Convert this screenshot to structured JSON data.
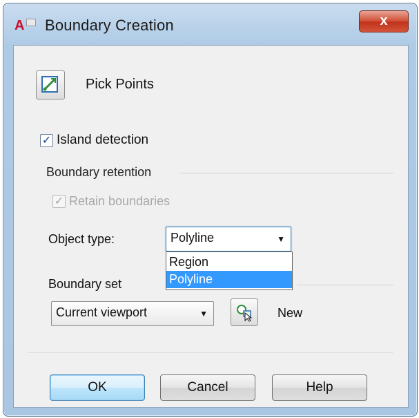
{
  "window": {
    "title": "Boundary Creation",
    "app_icon_letters": "A",
    "close_label": "x"
  },
  "pick_points": {
    "label": "Pick Points"
  },
  "island_detection": {
    "label": "Island detection",
    "checked": true,
    "check_mark": "✓"
  },
  "boundary_retention": {
    "heading": "Boundary retention",
    "retain": {
      "label": "Retain boundaries",
      "checked": true,
      "enabled": false,
      "check_mark": "✓"
    },
    "object_type": {
      "label": "Object type:",
      "selected": "Polyline",
      "options": [
        "Region",
        "Polyline"
      ],
      "highlighted": "Polyline"
    }
  },
  "boundary_set": {
    "heading": "Boundary set",
    "selected": "Current viewport",
    "new_label": "New"
  },
  "buttons": {
    "ok": "OK",
    "cancel": "Cancel",
    "help": "Help"
  },
  "icons": {
    "pick_points": "pick-points-icon",
    "new_set": "select-objects-icon",
    "dropdown_arrow": "▼"
  },
  "colors": {
    "selection": "#3399ff",
    "close_button": "#c0321b",
    "focus_border": "#3c7fb1"
  }
}
